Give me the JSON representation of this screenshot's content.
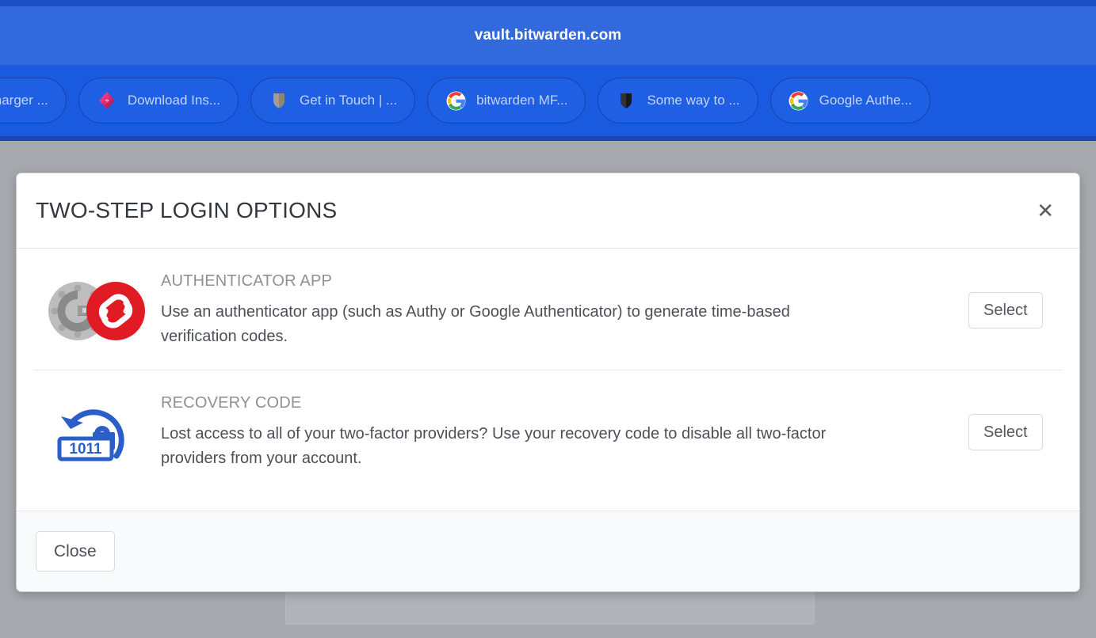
{
  "browser": {
    "url": "vault.bitwarden.com",
    "tabs": [
      {
        "label": "l Charger ...",
        "favicon": "none-icon",
        "truncated_start": true
      },
      {
        "label": "Download Ins...",
        "favicon": "bitwarden-pink-shield-icon"
      },
      {
        "label": "Get in Touch | ...",
        "favicon": "gray-shield-icon"
      },
      {
        "label": "bitwarden MF...",
        "favicon": "google-g-icon"
      },
      {
        "label": "Some way to ...",
        "favicon": "dark-shield-icon"
      },
      {
        "label": "Google Authe...",
        "favicon": "google-g-icon"
      }
    ]
  },
  "modal": {
    "title": "TWO-STEP LOGIN OPTIONS",
    "close_icon_label": "✕",
    "options": [
      {
        "icon": "authenticator-apps-icon",
        "title": "AUTHENTICATOR APP",
        "description": "Use an authenticator app (such as Authy or Google Authenticator) to generate time-based verification codes.",
        "action_label": "Select"
      },
      {
        "icon": "recovery-code-icon",
        "icon_digits": "1011",
        "title": "RECOVERY CODE",
        "description": "Lost access to all of your two-factor providers? Use your recovery code to disable all two-factor providers from your account.",
        "action_label": "Select"
      }
    ],
    "footer": {
      "close_label": "Close"
    }
  },
  "colors": {
    "chrome_top_strip": "#1b4fc4",
    "chrome_urlbar": "#3269dd",
    "chrome_tabstrip": "#1a5ae0",
    "backdrop": "#a6a9ae",
    "modal_bg": "#ffffff",
    "modal_footer_bg": "#f9fafb",
    "title_text": "#34383d",
    "option_title_text": "#8d9196",
    "body_text": "#4c5056",
    "recovery_icon_blue": "#2b5fc7",
    "authy_red": "#e01b24"
  }
}
